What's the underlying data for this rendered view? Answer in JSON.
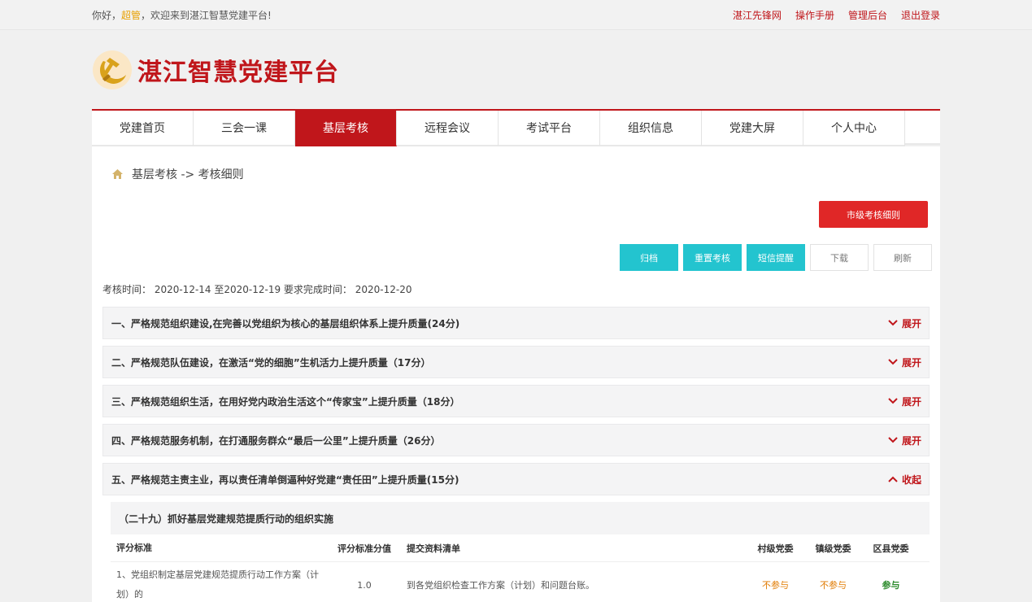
{
  "topbar": {
    "greeting_prefix": "你好，",
    "username": "超管",
    "greeting_suffix": "，欢迎来到湛江智慧党建平台!",
    "links": [
      "湛江先锋网",
      "操作手册",
      "管理后台",
      "退出登录"
    ]
  },
  "header": {
    "title": "湛江智慧党建平台"
  },
  "nav": {
    "items": [
      "党建首页",
      "三会一课",
      "基层考核",
      "远程会议",
      "考试平台",
      "组织信息",
      "党建大屏",
      "个人中心"
    ],
    "active": "基层考核"
  },
  "breadcrumb": {
    "text": "基层考核 -> 考核细则"
  },
  "buttons": {
    "city": "市级考核细则",
    "archive": "归档",
    "reassess": "重置考核",
    "sms": "短信提醒",
    "download": "下载",
    "refresh": "刷新"
  },
  "exam_time": "考核时间： 2020-12-14 至2020-12-19 要求完成时间： 2020-12-20",
  "sections": [
    {
      "title": "一、严格规范组织建设,在完善以党组织为核心的基层组织体系上提升质量(24分)",
      "toggle": "展开"
    },
    {
      "title": "二、严格规范队伍建设，在激活“党的细胞”生机活力上提升质量（17分）",
      "toggle": "展开"
    },
    {
      "title": "三、严格规范组织生活，在用好党内政治生活这个“传家宝”上提升质量（18分）",
      "toggle": "展开"
    },
    {
      "title": "四、严格规范服务机制，在打通服务群众“最后一公里”上提升质量（26分）",
      "toggle": "展开"
    },
    {
      "title": "五、严格规范主责主业，再以责任清单倒逼种好党建“责任田”上提升质量(15分)",
      "toggle": "收起"
    }
  ],
  "subsection": {
    "title": "（二十九）抓好基层党建规范提质行动的组织实施",
    "headers": [
      "评分标准",
      "评分标准分值",
      "提交资料清单",
      "村级党委",
      "镇级党委",
      "区县党委"
    ],
    "rows": [
      {
        "criteria": "1、党组织制定基层党建规范提质行动工作方案（计划）的",
        "score": "1.0",
        "materials": "到各党组织检查工作方案（计划）和问题台账。",
        "village": "不参与",
        "town": "不参与",
        "county": "参与"
      }
    ]
  },
  "colors": {
    "brand_red": "#c0161b",
    "teal": "#23c4cf",
    "orange": "#e07a00",
    "green": "#2a8a2a"
  }
}
